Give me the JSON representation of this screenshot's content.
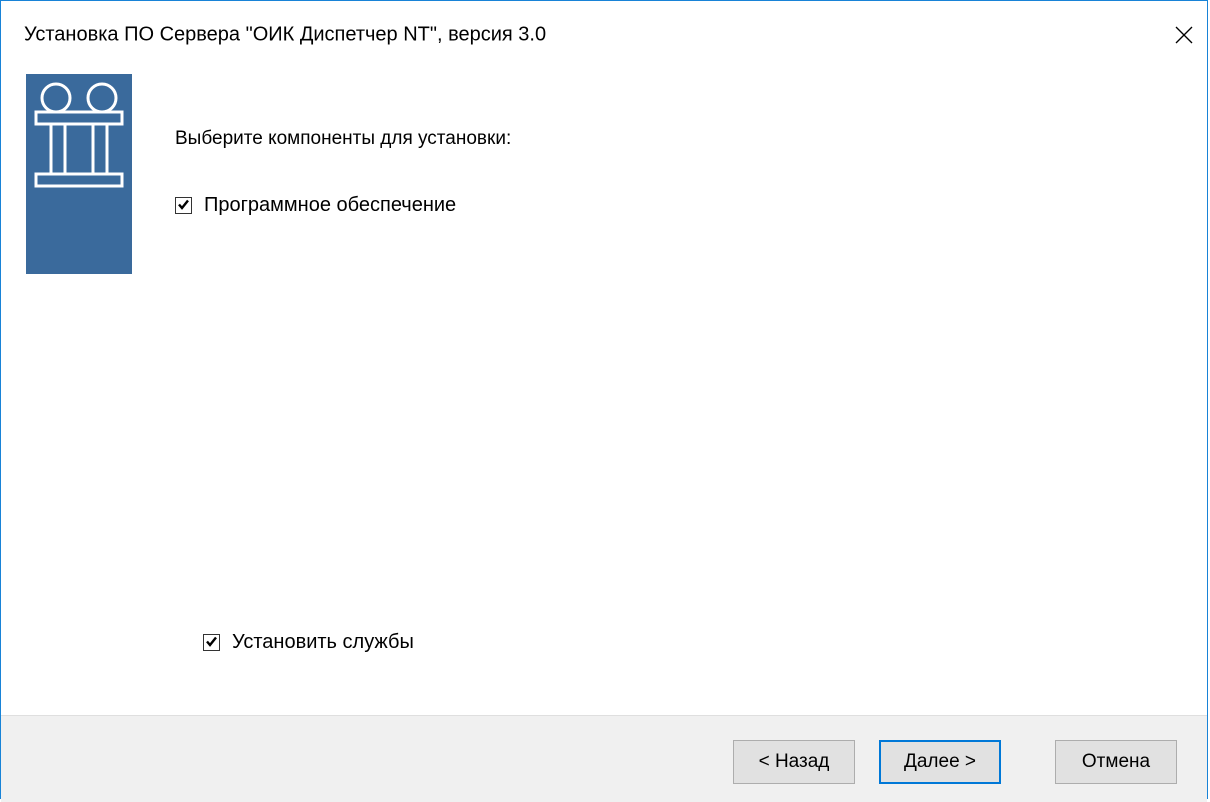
{
  "window": {
    "title": "Установка ПО Сервера \"ОИК Диспетчер NT\", версия 3.0",
    "close_icon": "close-icon"
  },
  "logo": {
    "icon": "oik-logo-icon",
    "background_color": "#3a6a9c"
  },
  "main": {
    "heading": "Выберите компоненты для установки:",
    "components": [
      {
        "label": "Программное обеспечение",
        "checked": true
      }
    ],
    "install_services": {
      "label": "Установить службы",
      "checked": true
    }
  },
  "footer": {
    "back_label": "< Назад",
    "next_label": "Далее >",
    "cancel_label": "Отмена"
  },
  "colors": {
    "window_border": "#1883d7",
    "footer_bg": "#f0f0f0",
    "button_bg": "#e1e1e1",
    "default_button_border": "#0078d7"
  }
}
